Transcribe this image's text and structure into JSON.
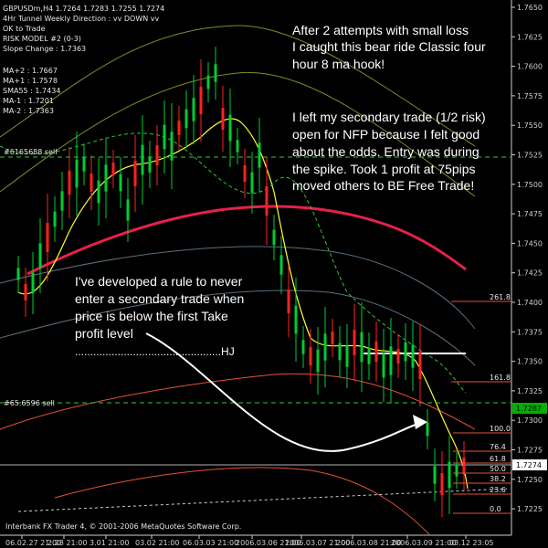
{
  "header": {
    "line1": "GBPUSDm,H4  1.7264 1.7283 1.7255 1.7274",
    "line2": "4Hr Tunnel Weekly Direction : vv DOWN vv",
    "line3": "OK to Trade",
    "line4": "RISK MODEL #2 (0-3)",
    "line5": "Slope Change : 1.7363"
  },
  "ma_panel": [
    "MA+2 : 1.7667",
    "MA+1 : 1.7578",
    "SMA55 : 1.7434",
    "MA-1 : 1.7201",
    "MA-2 : 1.7363"
  ],
  "order_labels": {
    "sell1": "#6165688 sell",
    "sell2": "#65.6596 sell"
  },
  "annotations": {
    "note1": [
      "After 2 attempts with small loss",
      "I caught this bear ride Classic four",
      "hour 8 ma hook!"
    ],
    "note2": [
      "I left my secondary trade (1/2 risk)",
      "open for NFP because I felt good",
      "about the odds.  Entry was during",
      "the spike.  Took 1 profit at 75pips",
      "moved others to BE Free Trade!"
    ],
    "note3": [
      " I've developed a rule to never",
      "enter a secondary trade when",
      "price is below the first Take",
      "profit level"
    ],
    "signature": "................................................HJ"
  },
  "price_axis": {
    "labels": [
      "1.7650",
      "1.7625",
      "1.7600",
      "1.7575",
      "1.7550",
      "1.7525",
      "1.7500",
      "1.7475",
      "1.7450",
      "1.7425",
      "1.7400",
      "1.7375",
      "1.7350",
      "1.7325",
      "1.7300",
      "1.7275",
      "1.7250",
      "1.7225"
    ],
    "current_green": "1.7287",
    "current_white": "1.7274"
  },
  "fib_levels": [
    "261.8",
    "161.8",
    "100.0",
    "76.4",
    "61.8",
    "50.0",
    "38.2",
    "23.6",
    "0.0"
  ],
  "time_axis": [
    "06.02.27 21:00",
    "2.28 21:00",
    "3.01 21:00",
    "03.02 21:00",
    "06.03.03 21:00",
    "2006.03.06 21:00",
    "2006.03.07 21:00",
    "2006.03.08 21:00",
    "2006.03.09 21:00",
    "03.12 23:05"
  ],
  "footer": "Interbank FX Trader 4, © 2001-2006 MetaQuotes Software Corp.",
  "colors": {
    "bull": "#00cc33",
    "bear": "#ff2020",
    "ema": "#ffff33",
    "redband": "#e8204a",
    "upper": "#8a9a2a",
    "lower": "#6a8090",
    "green_dash": "#2fcb2f",
    "sma_red": "#ff5a3a",
    "current_green": "#00b000"
  }
}
